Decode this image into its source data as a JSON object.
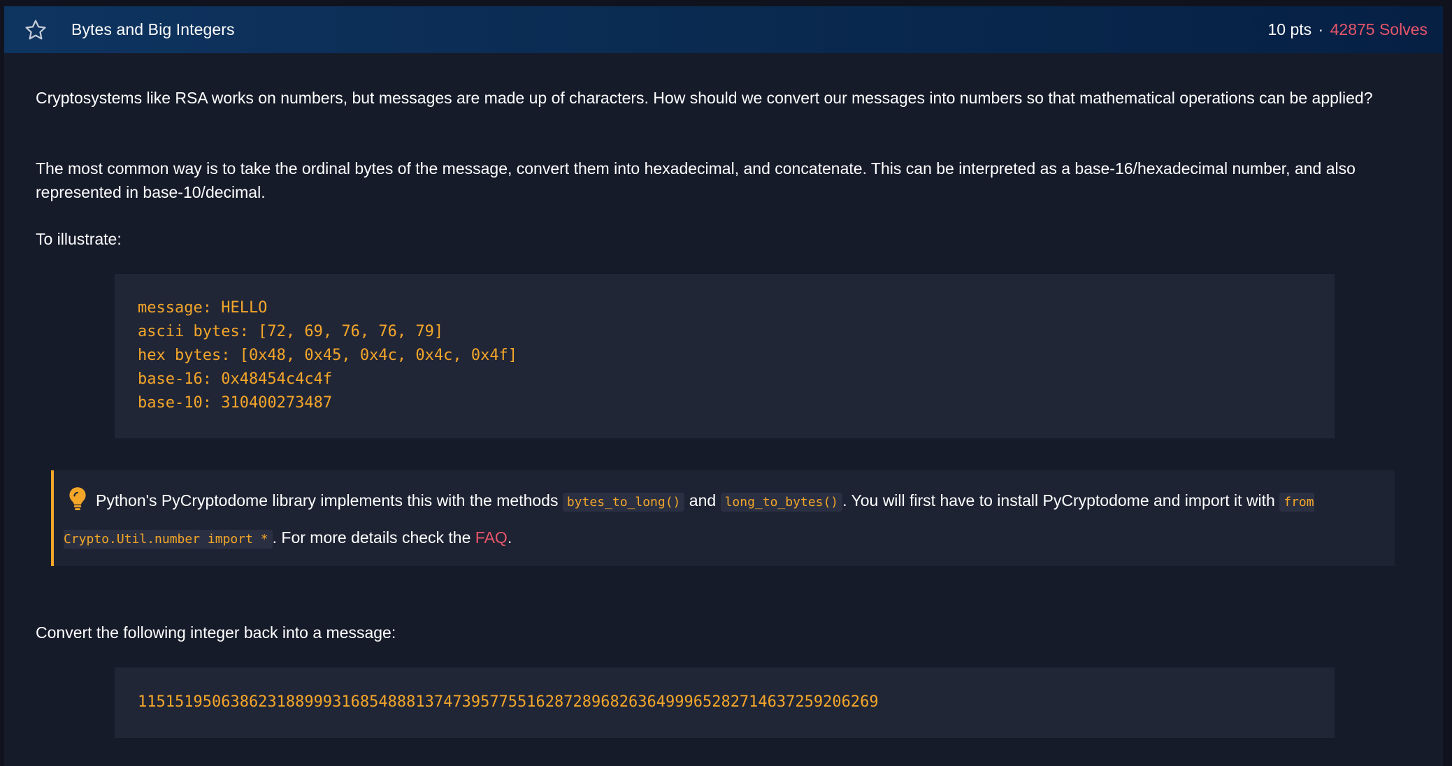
{
  "challenge": {
    "title": "Bytes and Big Integers",
    "points": "10 pts",
    "separator": "·",
    "solves": "42875 Solves"
  },
  "description": {
    "paragraph1": "Cryptosystems like RSA works on numbers, but messages are made up of characters. How should we convert our messages into numbers so that mathematical operations can be ap­plied?",
    "paragraph2": "The most common way is to take the ordinal bytes of the message, convert them into hexadecimal, and concatenate. This can be interpreted as a base-16/hexadecimal number, and also represented in base-10/decimal.",
    "paragraph3": "To illustrate:",
    "example_lines": [
      "message: HELLO",
      "ascii bytes: [72, 69, 76, 76, 79]",
      "hex bytes: [0x48, 0x45, 0x4c, 0x4c, 0x4f]",
      "base-16: 0x48454c4c4f",
      "base-10: 310400273487"
    ]
  },
  "tip": {
    "icon": "lightbulb-icon",
    "text1": "Python's PyCryptodome library implements this with the methods ",
    "code1": "bytes_to_long()",
    "text2": " and ",
    "code2": "long_to_bytes()",
    "text3": ". You will first have to install PyCryptodome and import it with ",
    "code3": "from Crypto.Util.number import *",
    "text4": ". For more details check the ",
    "link": "FAQ",
    "text5": "."
  },
  "task": {
    "prompt": "Convert the following integer back into a message:",
    "integer": "11515195063862318899931685488813747395775516287289682636499965282714637259206269"
  },
  "colors": {
    "accent_orange": "#f4a629",
    "accent_red": "#e8556a",
    "header_bg": "#0a2a50",
    "panel_bg": "#161b2a",
    "code_bg": "#212637"
  }
}
